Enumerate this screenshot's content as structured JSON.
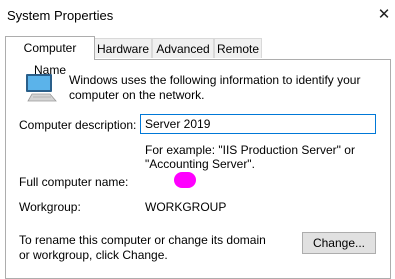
{
  "window": {
    "title": "System Properties",
    "close_glyph": "✕"
  },
  "tabs": [
    {
      "label": "Computer Name",
      "active": true
    },
    {
      "label": "Hardware",
      "active": false
    },
    {
      "label": "Advanced",
      "active": false
    },
    {
      "label": "Remote",
      "active": false
    }
  ],
  "computer_name": {
    "icon": "computer-icon",
    "info_text": "Windows uses the following information to identify your computer on the network.",
    "description_label": "Computer description:",
    "description_value": "Server 2019",
    "example_text": "For example: \"IIS Production Server\" or \"Accounting Server\".",
    "full_name_label": "Full computer name:",
    "full_name_value": "",
    "workgroup_label": "Workgroup:",
    "workgroup_value": "WORKGROUP",
    "rename_text": "To rename this computer or change its domain or workgroup, click Change.",
    "change_button": "Change..."
  },
  "colors": {
    "redaction": "#ff00ff",
    "focus_border": "#0078d7"
  }
}
